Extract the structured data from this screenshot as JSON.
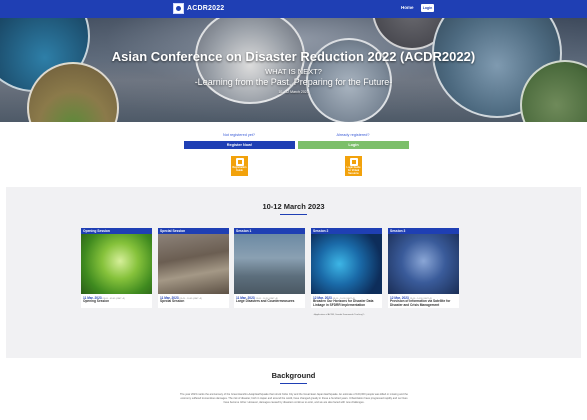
{
  "nav": {
    "brand": "ACDR2022",
    "home": "Home",
    "login": "Login"
  },
  "hero": {
    "title": "Asian Conference on Disaster Reduction 2022 (ACDR2022)",
    "subtitle1": "WHAT IS NEXT?",
    "subtitle2": "-Learning from the Past, Preparing for the Future-",
    "date": "10 - 12 March 2023"
  },
  "registration": {
    "not_registered": "Not registered yet?",
    "already_registered": "Already registered?",
    "register_button": "Register Now!",
    "login_button": "Login",
    "tile1_label": "Registration Guide",
    "tile2_label": "Login Guide for Virtual Sessions"
  },
  "sessions": {
    "heading": "10-12 March 2023",
    "cards": [
      {
        "tag": "Opening Session",
        "date": "11 Mar. 2023",
        "time": "09:00 - 09:45 (GMT+9)",
        "name": "Opening Session",
        "note": ""
      },
      {
        "tag": "Special Session",
        "date": "11 Mar. 2023",
        "time": "09:45 - 10:45 (GMT+9)",
        "name": "Special Session",
        "note": ""
      },
      {
        "tag": "Session 1",
        "date": "11 Mar. 2023",
        "time": "13:00 - 14:30 (GMT+9)",
        "name": "Large Disasters and Countermeasures",
        "note": ""
      },
      {
        "tag": "Session 2",
        "date": "12 Mar. 2023",
        "time": "09:00 - 10:30 (GMT+9)",
        "name": "Broaden Our Horizons for Disaster Data Linkage in SFDRR Implementation",
        "note": "~Application of ACDR, Sendai Framework Tracking?~"
      },
      {
        "tag": "Session 3",
        "date": "12 Mar. 2023",
        "time": "13:00 - 14:30 (GMT+9)",
        "name": "Provision of Information via Satellite for Disaster and Crisis Management",
        "note": ""
      }
    ]
  },
  "background": {
    "heading": "Background",
    "text": "The year 2023 marks the anniversary of the Great Hanshin-Awaji Earthquake that struck Kobe City and the Great East Japan Earthquake. An estimate of 100,000 people was killed or missing and the economy suffered tremendous damages. The risk of disaster, both in Japan and around the world, have changed greatly in these a hundred years. Urbanization have progressed rapidly and our lives have become richer. However, damages caused by disasters continue to exist, and we are also faced with new challenges."
  },
  "colors": {
    "primary": "#1f3fb4",
    "login_green": "#7cbf6a",
    "tile_orange": "#f2a20c"
  }
}
